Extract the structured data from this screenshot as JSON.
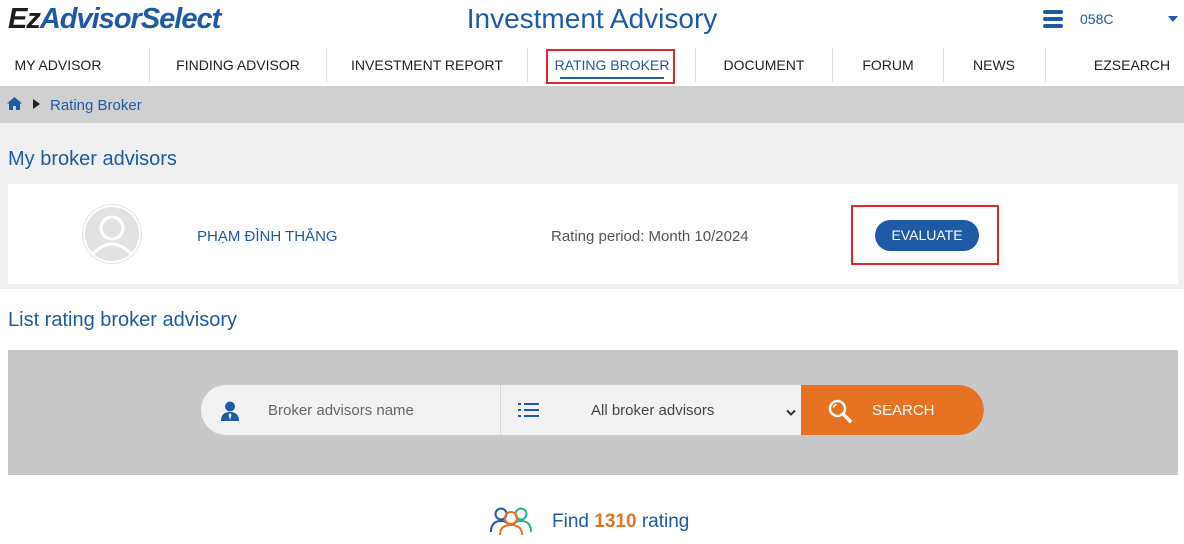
{
  "brand": {
    "logo_part1": "Ez",
    "logo_part2": "AdvisorSelect"
  },
  "header": {
    "title": "Investment Advisory",
    "user_code": "058C"
  },
  "nav": {
    "items": [
      {
        "label": "MY ADVISOR"
      },
      {
        "label": "FINDING ADVISOR"
      },
      {
        "label": "INVESTMENT REPORT"
      },
      {
        "label": "RATING BROKER"
      },
      {
        "label": "DOCUMENT"
      },
      {
        "label": "FORUM"
      },
      {
        "label": "NEWS"
      },
      {
        "label": "EZSEARCH"
      }
    ],
    "active": "RATING BROKER"
  },
  "breadcrumb": {
    "current": "Rating Broker"
  },
  "my_advisors": {
    "title": "My broker advisors",
    "advisor": {
      "name": "PHẠM ĐÌNH THẮNG",
      "rating_period": "Rating period: Month 10/2024",
      "evaluate_label": "EVALUATE"
    }
  },
  "list": {
    "title": "List rating broker advisory",
    "search": {
      "name_placeholder": "Broker advisors name",
      "filter_selected": "All broker advisors",
      "search_label": "SEARCH"
    },
    "result": {
      "prefix": "Find",
      "count": "1310",
      "suffix": "rating"
    }
  },
  "colors": {
    "brand_blue": "#1f5aa6",
    "accent_orange": "#e87224",
    "highlight_red": "#e0262e"
  }
}
